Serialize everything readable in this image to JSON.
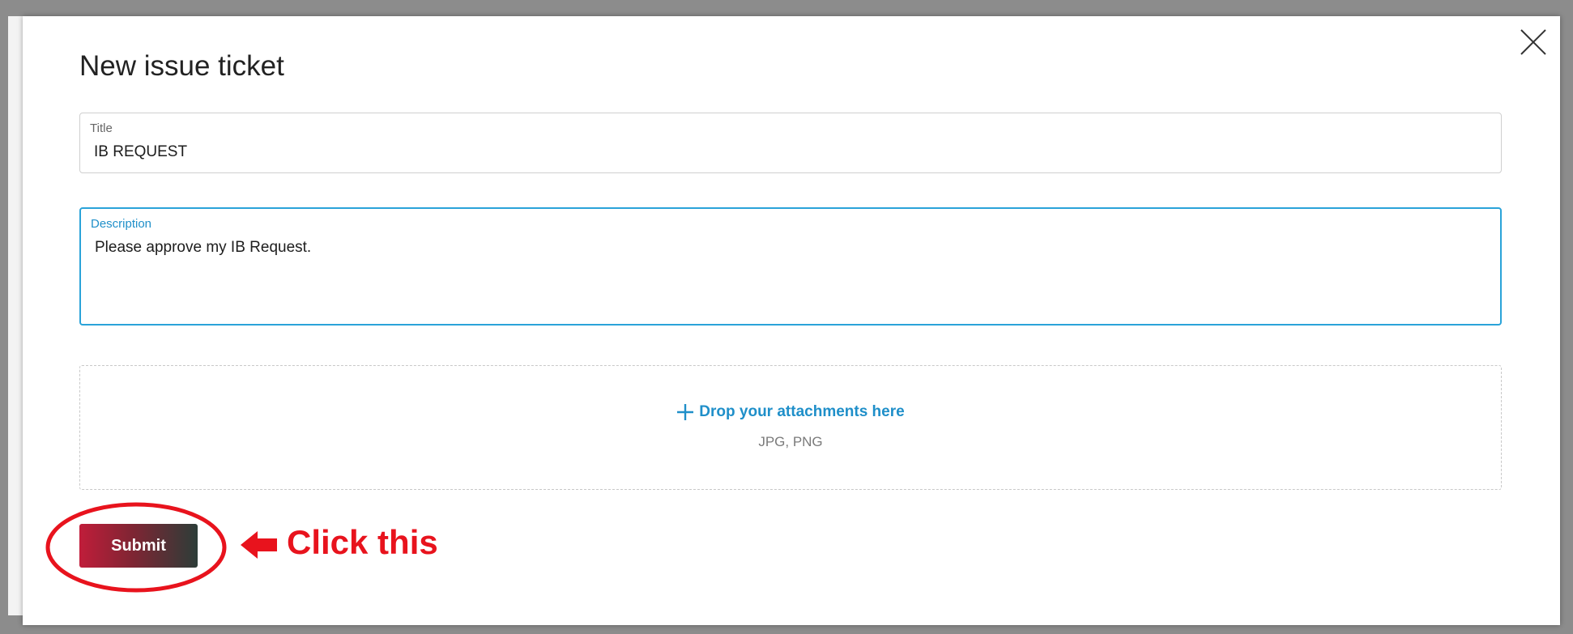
{
  "dialog": {
    "title": "New issue ticket",
    "close_icon": "close-icon"
  },
  "title_field": {
    "label": "Title",
    "value": "IB REQUEST"
  },
  "description_field": {
    "label": "Description",
    "value": "Please approve my IB Request."
  },
  "attachments": {
    "icon": "plus-icon",
    "label": "Drop your attachments here",
    "formats": "JPG, PNG"
  },
  "submit": {
    "label": "Submit"
  },
  "annotation": {
    "text": "Click this",
    "icon": "arrow-left-icon"
  },
  "colors": {
    "accent": "#1f8fc9",
    "annotation": "#e8131d",
    "submit_start": "#c01d3a",
    "submit_end": "#2c3d38"
  }
}
